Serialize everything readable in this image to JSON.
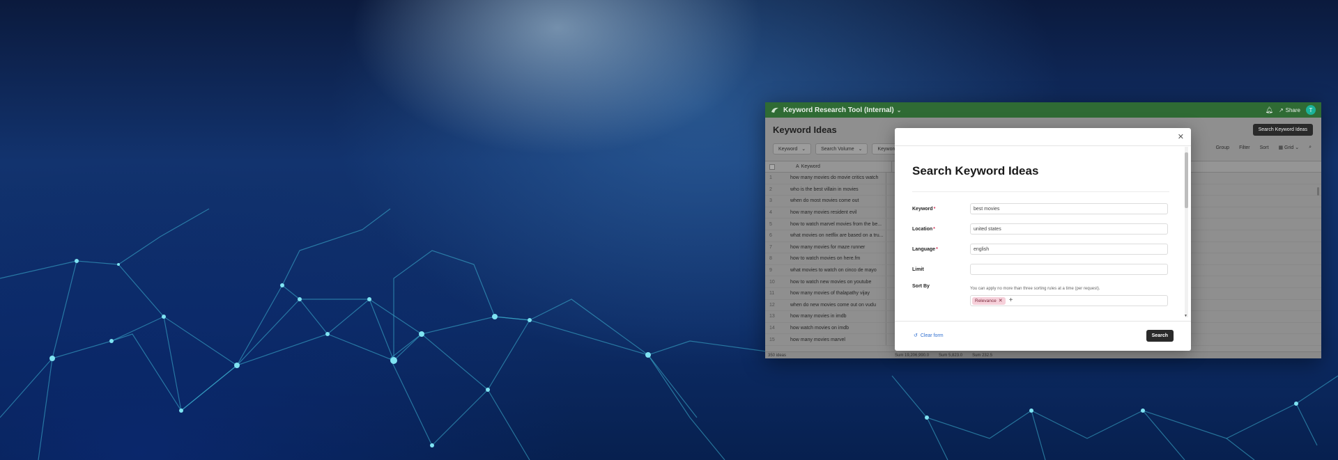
{
  "app": {
    "title": "Keyword Research Tool (Internal)",
    "share_label": "Share",
    "avatar_initial": "T",
    "notification_count": "1"
  },
  "page": {
    "title": "Keyword Ideas",
    "search_button": "Search Keyword Ideas"
  },
  "filters": [
    "Keyword",
    "Search Volume",
    "Keyword Diffi"
  ],
  "toolbar": {
    "group": "Group",
    "filter": "Filter",
    "sort": "Sort",
    "view": "Grid"
  },
  "grid": {
    "column_keyword": "Keyword",
    "rows": [
      {
        "n": "1",
        "keyword": "how many movies do movie critics watch"
      },
      {
        "n": "2",
        "keyword": "who is the best villain in movies"
      },
      {
        "n": "3",
        "keyword": "when do most movies come out"
      },
      {
        "n": "4",
        "keyword": "how many movies resident evil"
      },
      {
        "n": "5",
        "keyword": "how to watch marvel movies from the be..."
      },
      {
        "n": "6",
        "keyword": "what movies on netflix are based on a tru..."
      },
      {
        "n": "7",
        "keyword": "how many movies for maze runner"
      },
      {
        "n": "8",
        "keyword": "how to watch movies on here.fm"
      },
      {
        "n": "9",
        "keyword": "what movies to watch on cinco de mayo"
      },
      {
        "n": "10",
        "keyword": "how to watch new movies on youtube"
      },
      {
        "n": "11",
        "keyword": "how many movies of thalapathy vijay"
      },
      {
        "n": "12",
        "keyword": "when do new movies come out on vudu"
      },
      {
        "n": "13",
        "keyword": "how many movies in imdb"
      },
      {
        "n": "14",
        "keyword": "how watch movies on imdb"
      },
      {
        "n": "15",
        "keyword": "how many movies marvel"
      }
    ],
    "footer_count": "350 ideas",
    "sums": [
      "Sum 19,206,990.0",
      "Sum 5,823.0",
      "Sum 232.5"
    ]
  },
  "modal": {
    "title": "Search Keyword Ideas",
    "fields": {
      "keyword": {
        "label": "Keyword",
        "value": "best movies"
      },
      "location": {
        "label": "Location",
        "value": "united states"
      },
      "language": {
        "label": "Language",
        "value": "english"
      },
      "limit": {
        "label": "Limit",
        "value": ""
      },
      "sort_by": {
        "label": "Sort By",
        "help": "You can apply no more than three sorting rules at a time (per request).",
        "tag": "Relevance"
      }
    },
    "required_mark": "*",
    "clear_label": "Clear form",
    "submit_label": "Search"
  },
  "colors": {
    "header_green": "#2f6b34",
    "accent_link": "#2f6fd0",
    "tag_pink": "#f6d0da",
    "required_red": "#d6365a"
  }
}
